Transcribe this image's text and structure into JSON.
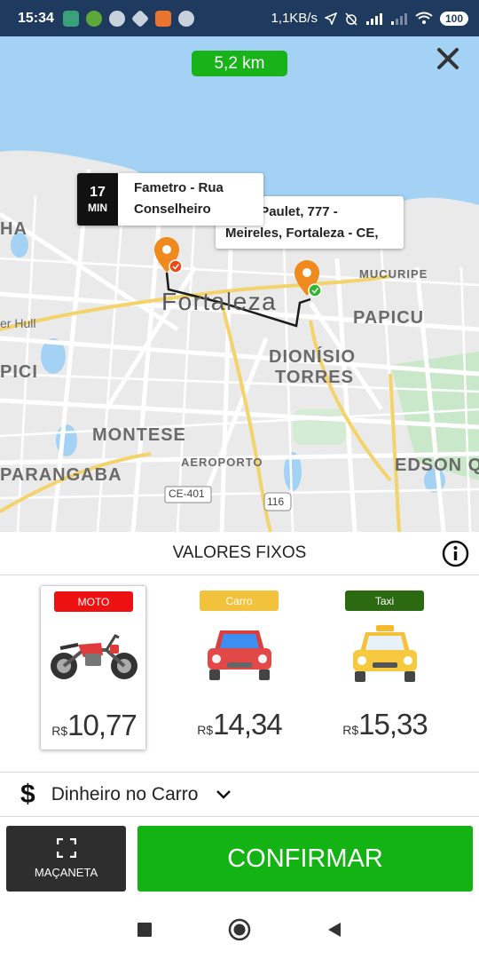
{
  "status_bar": {
    "time": "15:34",
    "network_speed": "1,1KB/s",
    "battery": "100"
  },
  "map": {
    "distance": "5,2 km",
    "origin": {
      "eta_value": "17",
      "eta_unit": "MIN",
      "line1": "Fametro - Rua",
      "line2": "Conselheiro"
    },
    "destination": {
      "line1": "Silva Paulet, 777 -",
      "line2": "Meireles, Fortaleza - CE,"
    },
    "labels": {
      "city": "Fortaleza",
      "mucuripe": "MUCURIPE",
      "papicu": "PAPICU",
      "dionisio1": "DIONÍSIO",
      "dionisio2": "TORRES",
      "montese": "MONTESE",
      "parangaba": "PARANGABA",
      "aeroporto": "AEROPORTO",
      "edson": "EDSON Q",
      "ha": "HA",
      "pici": "PICI",
      "hull": "er Hull",
      "ce401": "CE-401",
      "br116": "116"
    }
  },
  "values_header": "VALORES FIXOS",
  "vehicles": [
    {
      "tag": "MOTO",
      "tag_color": "#ee1111",
      "currency": "R$",
      "price": "10,77",
      "icon": "motorcycle-icon"
    },
    {
      "tag": "Carro",
      "tag_color": "#f2c23c",
      "currency": "R$",
      "price": "14,34",
      "icon": "car-icon"
    },
    {
      "tag": "Taxi",
      "tag_color": "#2c6a12",
      "currency": "R$",
      "price": "15,33",
      "icon": "taxi-icon"
    }
  ],
  "payment": {
    "symbol": "$",
    "label": "Dinheiro no Carro"
  },
  "actions": {
    "handle_label": "MAÇANETA",
    "confirm_label": "CONFIRMAR"
  },
  "colors": {
    "accent_green": "#13b313",
    "status_bar": "#1e3a5f",
    "water": "#a3d2f5"
  }
}
